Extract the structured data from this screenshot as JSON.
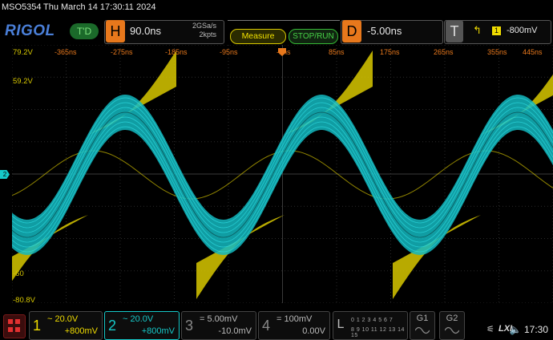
{
  "header": {
    "model": "MSO5354",
    "datetime": "Thu March 14 17:30:11 2024",
    "logo": "RIGOL",
    "td_label": "T'D",
    "h_key": "H",
    "timebase": "90.0ns",
    "sample_rate": "2GSa/s",
    "mem_depth": "2kpts",
    "measure_label": "Measure",
    "stoprun_label": "STOP/RUN",
    "d_key": "D",
    "delay": "-5.00ns",
    "t_key": "T",
    "trigger_source": "1",
    "trigger_level": "-800mV"
  },
  "grid": {
    "y_labels": [
      {
        "text": "79.2V",
        "pos": "top"
      },
      {
        "text": "59.2V",
        "pos": "upper"
      },
      {
        "text": "-60",
        "pos": "lower"
      },
      {
        "text": "-80.8V",
        "pos": "bottom"
      }
    ],
    "x_labels": [
      "-365ns",
      "-275ns",
      "-185ns",
      "-95ns",
      "-5ns",
      "85ns",
      "175ns",
      "265ns",
      "355ns",
      "445ns"
    ],
    "ch2_level_marker": "2"
  },
  "channels": [
    {
      "num": "1",
      "v1": "20.0V",
      "v2": "+800mV",
      "color": "#f0dc00",
      "coupling": "~"
    },
    {
      "num": "2",
      "v1": "20.0V",
      "v2": "+800mV",
      "color": "#16c8c8",
      "coupling": "~"
    },
    {
      "num": "3",
      "v1": "5.00mV",
      "v2": "-10.0mV",
      "color": "#888888",
      "coupling": "="
    },
    {
      "num": "4",
      "v1": "100mV",
      "v2": "0.00V",
      "color": "#888888",
      "coupling": "="
    }
  ],
  "logic": {
    "key": "L",
    "row1": "0 1 2 3  4 5 6 7",
    "row2": "8 9 10 11 12 13 14 15"
  },
  "generators": [
    "G1",
    "G2"
  ],
  "status": {
    "time": "17:30",
    "lxi": "LXI"
  },
  "colors": {
    "ch1": "#f0dc00",
    "ch2": "#16c8c8",
    "accent": "#e8781c"
  }
}
